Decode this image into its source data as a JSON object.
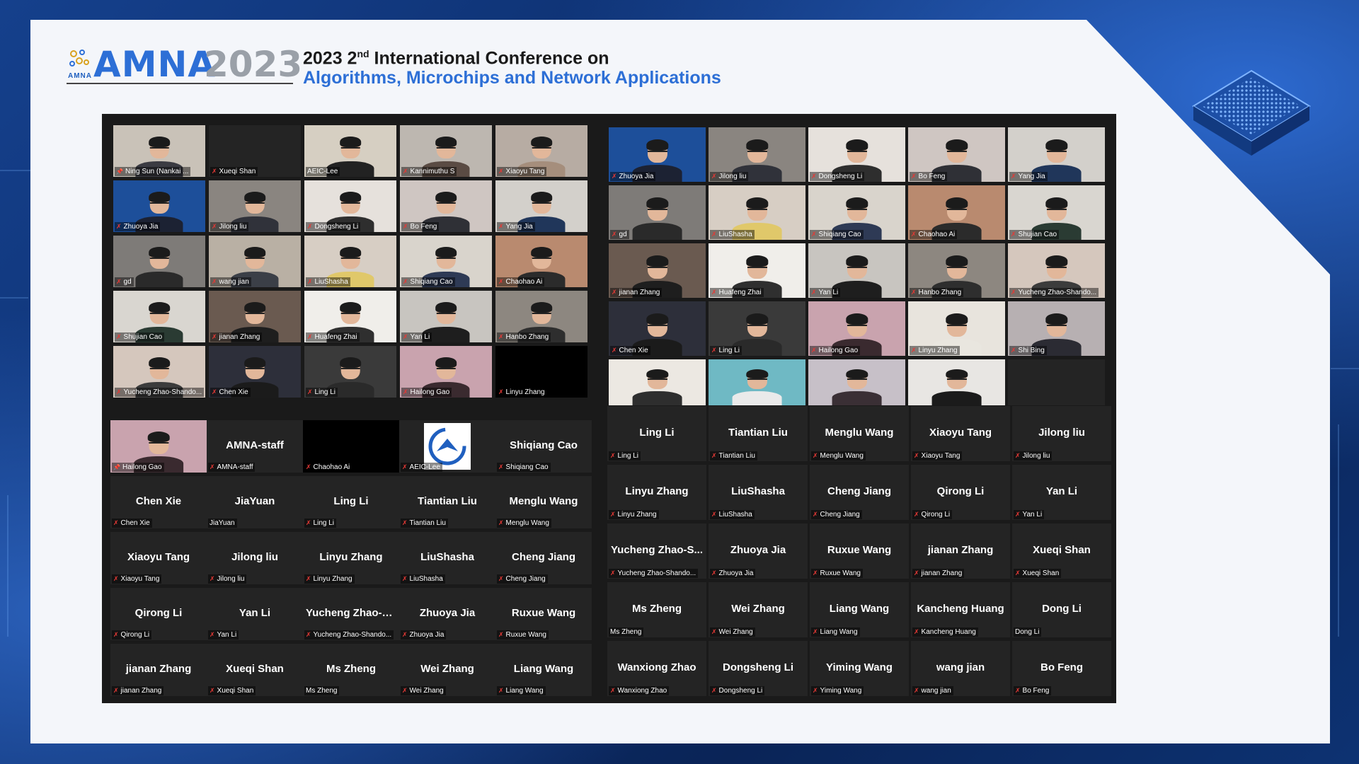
{
  "header": {
    "logo_small": "AMNA",
    "logo_text": "AMNA",
    "logo_year": "2023",
    "title_prefix": "2023 2",
    "title_sup": "nd",
    "title_rest": " International Conference on",
    "subtitle": "Algorithms, Microchips and Network Applications"
  },
  "left_video_tiles": [
    {
      "name": "Ning Sun (Nankai ...",
      "video": true,
      "pin": true,
      "bg": "#c9c2b8",
      "shirt": "#3b3b42"
    },
    {
      "name": "Xueqi Shan",
      "video": false
    },
    {
      "name": "AEIC-Lee",
      "video": true,
      "bg": "#d6cfc2",
      "shirt": "#222",
      "active": true,
      "mic": "none"
    },
    {
      "name": "Kannimuthu S",
      "video": true,
      "bg": "#bdb7b0",
      "shirt": "#5a4b43"
    },
    {
      "name": "Xiaoyu Tang",
      "video": true,
      "bg": "#b7aca3",
      "shirt": "#a58e7c"
    },
    {
      "name": "Zhuoya Jia",
      "video": true,
      "bg": "#1d4f9a",
      "shirt": "#1c2233"
    },
    {
      "name": "Jilong liu",
      "video": true,
      "bg": "#8a8580",
      "shirt": "#30323a"
    },
    {
      "name": "Dongsheng Li",
      "video": true,
      "bg": "#e6e1dc",
      "shirt": "#2e2e2e"
    },
    {
      "name": "Bo Feng",
      "video": true,
      "bg": "#cfc6c2",
      "shirt": "#2f3036"
    },
    {
      "name": "Yang Jia",
      "video": true,
      "bg": "#d3d0cb",
      "shirt": "#20365a"
    },
    {
      "name": "gd",
      "video": true,
      "bg": "#7e7b78",
      "shirt": "#2a2a2a"
    },
    {
      "name": "wang jian",
      "video": true,
      "bg": "#b9b0a4",
      "shirt": "#3b3f47"
    },
    {
      "name": "LiuShasha",
      "video": true,
      "bg": "#d7cec4",
      "shirt": "#e0c86a"
    },
    {
      "name": "Shiqiang Cao",
      "video": true,
      "bg": "#d9d4cc",
      "shirt": "#2e3a55"
    },
    {
      "name": "Chaohao Ai",
      "video": true,
      "bg": "#b98a6f",
      "shirt": "#2b2b2b"
    },
    {
      "name": "Shujian Cao",
      "video": true,
      "bg": "#d9d6d0",
      "shirt": "#2a3b33"
    },
    {
      "name": "jianan Zhang",
      "video": true,
      "bg": "#6a5a50",
      "shirt": "#1e1e1e"
    },
    {
      "name": "Huafeng Zhai",
      "video": true,
      "bg": "#f0eeea",
      "shirt": "#2f2f2f"
    },
    {
      "name": "Yan Li",
      "video": true,
      "bg": "#c8c5c0",
      "shirt": "#1e1e1e"
    },
    {
      "name": "Hanbo Zhang",
      "video": true,
      "bg": "#8d8780",
      "shirt": "#2e2e2e"
    },
    {
      "name": "Yucheng Zhao-Shando...",
      "video": true,
      "bg": "#d5c7bd",
      "shirt": "#3c3c3c"
    },
    {
      "name": "Chen Xie",
      "video": true,
      "bg": "#2d2f3a",
      "shirt": "#1b1b1b"
    },
    {
      "name": "Ling Li",
      "video": true,
      "bg": "#3a3a3a",
      "shirt": "#2a2a2a"
    },
    {
      "name": "Hailong Gao",
      "video": true,
      "bg": "#c9a3ae",
      "shirt": "#3a2a2f"
    },
    {
      "name": "Linyu Zhang",
      "video": false,
      "black": true
    }
  ],
  "left_name_tiles": [
    {
      "title": "",
      "name": "Hailong Gao",
      "video": true,
      "bg": "#c9a3ae",
      "shirt": "#3a2a2f",
      "active": true,
      "pin": true
    },
    {
      "title": "AMNA-staff",
      "name": "AMNA-staff"
    },
    {
      "title": "",
      "name": "Chaohao Ai",
      "black": true
    },
    {
      "title": "",
      "name": "AEIC-Lee",
      "logo": true
    },
    {
      "title": "Shiqiang Cao",
      "name": "Shiqiang Cao"
    },
    {
      "title": "Chen Xie",
      "name": "Chen Xie"
    },
    {
      "title": "JiaYuan",
      "name": "JiaYuan",
      "mic": "none"
    },
    {
      "title": "Ling Li",
      "name": "Ling Li"
    },
    {
      "title": "Tiantian Liu",
      "name": "Tiantian Liu"
    },
    {
      "title": "Menglu Wang",
      "name": "Menglu Wang"
    },
    {
      "title": "Xiaoyu Tang",
      "name": "Xiaoyu Tang"
    },
    {
      "title": "Jilong liu",
      "name": "Jilong liu"
    },
    {
      "title": "Linyu Zhang",
      "name": "Linyu Zhang"
    },
    {
      "title": "LiuShasha",
      "name": "LiuShasha"
    },
    {
      "title": "Cheng Jiang",
      "name": "Cheng Jiang"
    },
    {
      "title": "Qirong Li",
      "name": "Qirong Li"
    },
    {
      "title": "Yan Li",
      "name": "Yan Li"
    },
    {
      "title": "Yucheng Zhao-S...",
      "name": "Yucheng Zhao-Shando..."
    },
    {
      "title": "Zhuoya Jia",
      "name": "Zhuoya Jia"
    },
    {
      "title": "Ruxue Wang",
      "name": "Ruxue Wang"
    },
    {
      "title": "jianan Zhang",
      "name": "jianan Zhang"
    },
    {
      "title": "Xueqi Shan",
      "name": "Xueqi Shan"
    },
    {
      "title": "Ms Zheng",
      "name": "Ms Zheng",
      "mic": "none"
    },
    {
      "title": "Wei Zhang",
      "name": "Wei Zhang"
    },
    {
      "title": "Liang Wang",
      "name": "Liang Wang"
    }
  ],
  "right_video_tiles": [
    {
      "name": "Zhuoya Jia",
      "video": true,
      "bg": "#1d4f9a",
      "shirt": "#1c2233"
    },
    {
      "name": "Jilong liu",
      "video": true,
      "bg": "#8a8580",
      "shirt": "#30323a"
    },
    {
      "name": "Dongsheng Li",
      "video": true,
      "bg": "#e6e1dc",
      "shirt": "#2e2e2e"
    },
    {
      "name": "Bo Feng",
      "video": true,
      "bg": "#cfc6c2",
      "shirt": "#2f3036"
    },
    {
      "name": "Yang Jia",
      "video": true,
      "bg": "#d3d0cb",
      "shirt": "#20365a"
    },
    {
      "name": "gd",
      "video": true,
      "bg": "#7e7b78",
      "shirt": "#2a2a2a"
    },
    {
      "name": "LiuShasha",
      "video": true,
      "bg": "#d7cec4",
      "shirt": "#e0c86a"
    },
    {
      "name": "Shiqiang Cao",
      "video": true,
      "bg": "#d9d4cc",
      "shirt": "#2e3a55"
    },
    {
      "name": "Chaohao Ai",
      "video": true,
      "bg": "#b98a6f",
      "shirt": "#2b2b2b"
    },
    {
      "name": "Shujian Cao",
      "video": true,
      "bg": "#d9d6d0",
      "shirt": "#2a3b33"
    },
    {
      "name": "jianan Zhang",
      "video": true,
      "bg": "#6a5a50",
      "shirt": "#1e1e1e"
    },
    {
      "name": "Huafeng Zhai",
      "video": true,
      "bg": "#f0eeea",
      "shirt": "#2f2f2f"
    },
    {
      "name": "Yan Li",
      "video": true,
      "bg": "#c8c5c0",
      "shirt": "#1e1e1e"
    },
    {
      "name": "Hanbo Zhang",
      "video": true,
      "bg": "#8d8780",
      "shirt": "#2e2e2e"
    },
    {
      "name": "Yucheng Zhao-Shando...",
      "video": true,
      "bg": "#d5c7bd",
      "shirt": "#3c3c3c"
    },
    {
      "name": "Chen Xie",
      "video": true,
      "bg": "#2d2f3a",
      "shirt": "#1b1b1b"
    },
    {
      "name": "Ling Li",
      "video": true,
      "bg": "#3a3a3a",
      "shirt": "#2a2a2a"
    },
    {
      "name": "Hailong Gao",
      "video": true,
      "bg": "#c9a3ae",
      "shirt": "#3a2a2f"
    },
    {
      "name": "Linyu Zhang",
      "video": true,
      "bg": "#e8e4dd",
      "shirt": "#e9e6df"
    },
    {
      "name": "Shi Bing",
      "video": true,
      "bg": "#b7b0b2",
      "shirt": "#2b2b33"
    },
    {
      "name": "",
      "video": true,
      "bg": "#ece8e2",
      "shirt": "#2e2e2e",
      "cut": true
    },
    {
      "name": "",
      "video": true,
      "bg": "#6fb9c4",
      "shirt": "#eaeaea",
      "cut": true
    },
    {
      "name": "",
      "video": true,
      "bg": "#c7c0c8",
      "shirt": "#3a2f35",
      "cut": true
    },
    {
      "name": "",
      "video": true,
      "bg": "#e8e6e3",
      "shirt": "#1b1b1b",
      "cut": true
    },
    {
      "name": "",
      "video": false,
      "cut": true
    }
  ],
  "right_name_tiles": [
    {
      "title": "Ling Li",
      "name": "Ling Li"
    },
    {
      "title": "Tiantian Liu",
      "name": "Tiantian Liu"
    },
    {
      "title": "Menglu Wang",
      "name": "Menglu Wang"
    },
    {
      "title": "Xiaoyu Tang",
      "name": "Xiaoyu Tang"
    },
    {
      "title": "Jilong liu",
      "name": "Jilong liu"
    },
    {
      "title": "Linyu Zhang",
      "name": "Linyu Zhang"
    },
    {
      "title": "LiuShasha",
      "name": "LiuShasha"
    },
    {
      "title": "Cheng Jiang",
      "name": "Cheng Jiang"
    },
    {
      "title": "Qirong Li",
      "name": "Qirong Li"
    },
    {
      "title": "Yan Li",
      "name": "Yan Li"
    },
    {
      "title": "Yucheng Zhao-S...",
      "name": "Yucheng Zhao-Shando..."
    },
    {
      "title": "Zhuoya Jia",
      "name": "Zhuoya Jia"
    },
    {
      "title": "Ruxue Wang",
      "name": "Ruxue Wang"
    },
    {
      "title": "jianan Zhang",
      "name": "jianan Zhang"
    },
    {
      "title": "Xueqi Shan",
      "name": "Xueqi Shan"
    },
    {
      "title": "Ms Zheng",
      "name": "Ms Zheng",
      "mic": "none"
    },
    {
      "title": "Wei Zhang",
      "name": "Wei Zhang"
    },
    {
      "title": "Liang Wang",
      "name": "Liang Wang"
    },
    {
      "title": "Kancheng Huang",
      "name": "Kancheng Huang"
    },
    {
      "title": "Dong Li",
      "name": "Dong Li",
      "mic": "none"
    },
    {
      "title": "Wanxiong Zhao",
      "name": "Wanxiong Zhao"
    },
    {
      "title": "Dongsheng Li",
      "name": "Dongsheng Li"
    },
    {
      "title": "Yiming Wang",
      "name": "Yiming Wang"
    },
    {
      "title": "wang jian",
      "name": "wang jian"
    },
    {
      "title": "Bo Feng",
      "name": "Bo Feng"
    }
  ],
  "colors": {
    "active_border": "#d6e46a",
    "muted_mic": "#e53935",
    "brand_blue": "#2d6fd6"
  },
  "icons": {
    "muted": "mic-muted-icon",
    "pin": "pin-icon"
  }
}
